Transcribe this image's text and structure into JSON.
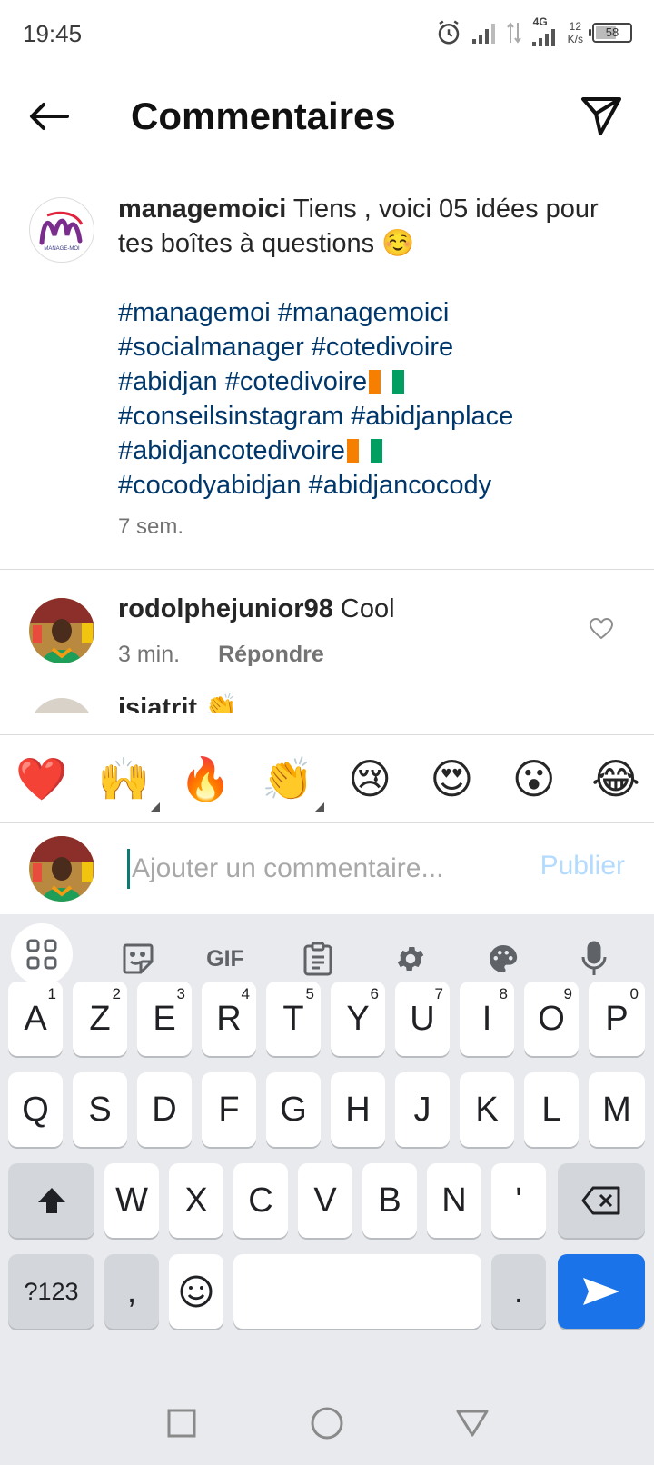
{
  "status_bar": {
    "time": "19:45",
    "network_label": "4G",
    "speed_value": "12",
    "speed_unit": "K/s",
    "battery_level": "58"
  },
  "header": {
    "title": "Commentaires"
  },
  "post": {
    "username": "managemoici",
    "caption": " Tiens , voici 05 idées pour tes boîtes à questions ☺️",
    "hashtags": [
      "#managemoi #managemoici",
      "#socialmanager #cotedivoire",
      "#abidjan #cotedivoire",
      "#conseilsinstagram #abidjanplace",
      "#abidjancotedivoire",
      "#cocodyabidjan #abidjancocody"
    ],
    "time": "7 sem.",
    "avatar_logo_text": "MANAGE-MOI"
  },
  "comment": {
    "username": "rodolphejunior98",
    "text": " Cool",
    "time": "3 min.",
    "reply_label": "Répondre"
  },
  "next_comment": {
    "username_partial": "isiatrit 👏"
  },
  "reactions": [
    "❤️",
    "🙌",
    "🔥",
    "👏",
    "😢",
    "😍",
    "😮",
    "😂"
  ],
  "composer": {
    "placeholder": "Ajouter un commentaire...",
    "publish_label": "Publier"
  },
  "keyboard": {
    "toolbar_gif": "GIF",
    "row1": [
      {
        "k": "A",
        "h": "1"
      },
      {
        "k": "Z",
        "h": "2"
      },
      {
        "k": "E",
        "h": "3"
      },
      {
        "k": "R",
        "h": "4"
      },
      {
        "k": "T",
        "h": "5"
      },
      {
        "k": "Y",
        "h": "6"
      },
      {
        "k": "U",
        "h": "7"
      },
      {
        "k": "I",
        "h": "8"
      },
      {
        "k": "O",
        "h": "9"
      },
      {
        "k": "P",
        "h": "0"
      }
    ],
    "row2": [
      "Q",
      "S",
      "D",
      "F",
      "G",
      "H",
      "J",
      "K",
      "L",
      "M"
    ],
    "row3": [
      "W",
      "X",
      "C",
      "V",
      "B",
      "N",
      "'"
    ],
    "symbols_label": "?123",
    "comma_label": ",",
    "period_label": "."
  },
  "colors": {
    "hashtag": "#00376b",
    "publish_disabled": "#b3dbff",
    "enter_key": "#1a73e8",
    "keyboard_bg": "#e8eaed"
  }
}
